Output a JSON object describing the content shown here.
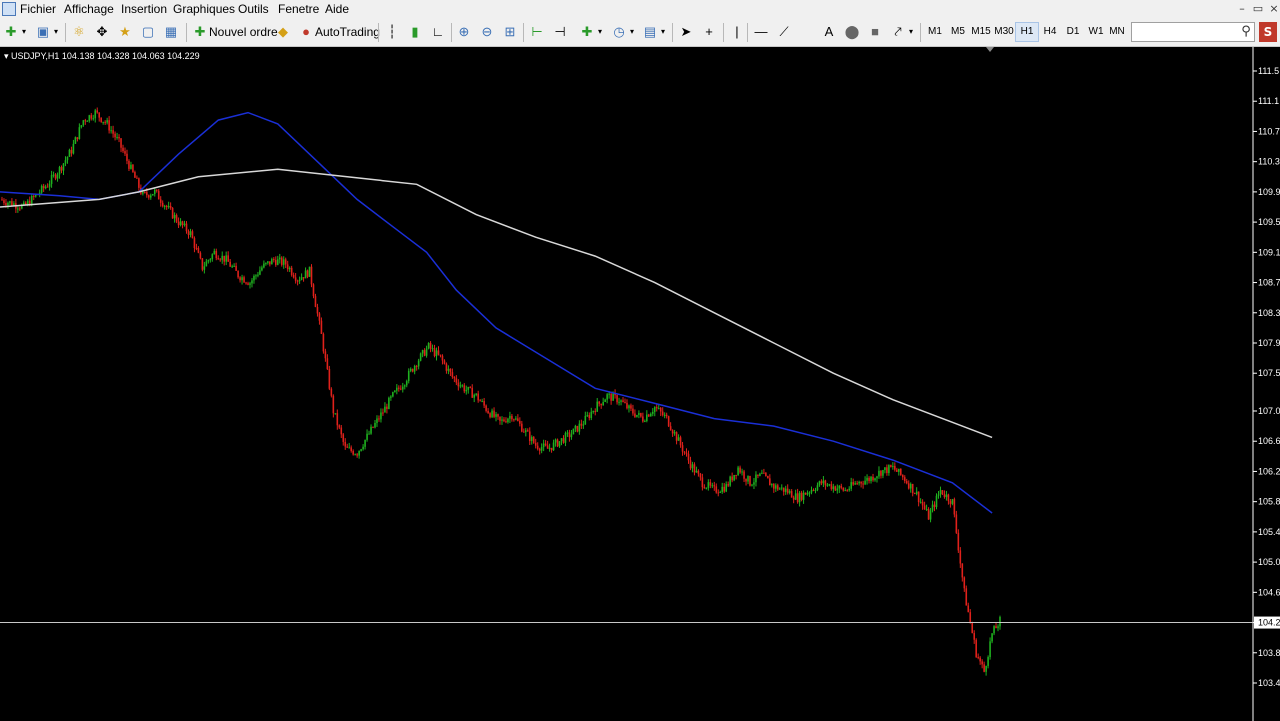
{
  "menu": {
    "items": [
      "Fichier",
      "Affichage",
      "Insertion",
      "Graphiques",
      "Outils",
      "Fenetre",
      "Aide"
    ]
  },
  "toolbar": {
    "new_order_label": "Nouvel ordre",
    "autotrading_label": "AutoTrading",
    "timeframes": [
      "M1",
      "M5",
      "M15",
      "M30",
      "H1",
      "H4",
      "D1",
      "W1",
      "MN"
    ],
    "active_timeframe": "H1",
    "search_value": ""
  },
  "chart_header": {
    "symbol_timeframe": "USDJPY,H1",
    "open": "104.138",
    "high": "104.328",
    "low": "104.063",
    "close": "104.229"
  },
  "colors": {
    "background": "#000000",
    "bull_candle": "#1fb11f",
    "bear_candle": "#e0211b",
    "ma_fast": "#1a2fd6",
    "ma_slow": "#d8d8d8",
    "price_line": "#c8c8c8",
    "axis_text": "#ffffff"
  },
  "chart_data": {
    "type": "candlestick",
    "symbol": "USDJPY",
    "timeframe": "H1",
    "ylim": [
      103.4,
      111.5
    ],
    "price_axis_ticks": [
      "111.5",
      "111.1",
      "110.7",
      "110.3",
      "109.9",
      "109.5",
      "109.1",
      "108.7",
      "108.3",
      "107.9",
      "107.5",
      "107.0",
      "106.6",
      "106.2",
      "105.8",
      "105.4",
      "105.0",
      "104.6",
      "104.2",
      "103.8",
      "103.4"
    ],
    "current_price": "104.2",
    "close_path": [
      [
        0,
        109.8
      ],
      [
        6,
        109.75
      ],
      [
        12,
        109.7
      ],
      [
        18,
        109.85
      ],
      [
        24,
        110.0
      ],
      [
        30,
        110.2
      ],
      [
        36,
        110.45
      ],
      [
        42,
        110.85
      ],
      [
        48,
        110.95
      ],
      [
        54,
        110.8
      ],
      [
        60,
        110.55
      ],
      [
        66,
        110.2
      ],
      [
        72,
        109.85
      ],
      [
        78,
        109.9
      ],
      [
        84,
        109.7
      ],
      [
        90,
        109.5
      ],
      [
        96,
        109.35
      ],
      [
        102,
        108.9
      ],
      [
        108,
        109.1
      ],
      [
        114,
        109.0
      ],
      [
        120,
        108.8
      ],
      [
        126,
        108.7
      ],
      [
        132,
        108.9
      ],
      [
        138,
        109.0
      ],
      [
        144,
        108.95
      ],
      [
        150,
        108.75
      ],
      [
        156,
        108.85
      ],
      [
        162,
        108.0
      ],
      [
        168,
        107.0
      ],
      [
        174,
        106.5
      ],
      [
        180,
        106.45
      ],
      [
        186,
        106.7
      ],
      [
        192,
        106.95
      ],
      [
        198,
        107.2
      ],
      [
        204,
        107.4
      ],
      [
        210,
        107.65
      ],
      [
        216,
        107.85
      ],
      [
        222,
        107.7
      ],
      [
        228,
        107.45
      ],
      [
        234,
        107.3
      ],
      [
        240,
        107.2
      ],
      [
        246,
        107.0
      ],
      [
        252,
        106.85
      ],
      [
        258,
        106.95
      ],
      [
        264,
        106.75
      ],
      [
        270,
        106.55
      ],
      [
        276,
        106.5
      ],
      [
        282,
        106.6
      ],
      [
        288,
        106.7
      ],
      [
        294,
        106.85
      ],
      [
        300,
        107.05
      ],
      [
        306,
        107.2
      ],
      [
        312,
        107.15
      ],
      [
        318,
        107.0
      ],
      [
        324,
        106.9
      ],
      [
        330,
        107.05
      ],
      [
        336,
        106.9
      ],
      [
        342,
        106.6
      ],
      [
        348,
        106.3
      ],
      [
        354,
        106.05
      ],
      [
        360,
        105.95
      ],
      [
        366,
        106.0
      ],
      [
        372,
        106.25
      ],
      [
        378,
        106.05
      ],
      [
        384,
        106.15
      ],
      [
        390,
        106.0
      ],
      [
        396,
        105.95
      ],
      [
        402,
        105.85
      ],
      [
        408,
        105.95
      ],
      [
        414,
        106.05
      ],
      [
        420,
        106.0
      ],
      [
        426,
        105.95
      ],
      [
        432,
        106.05
      ],
      [
        438,
        106.1
      ],
      [
        444,
        106.2
      ],
      [
        450,
        106.25
      ],
      [
        456,
        106.1
      ],
      [
        462,
        105.9
      ],
      [
        468,
        105.6
      ],
      [
        474,
        105.95
      ],
      [
        480,
        105.8
      ],
      [
        486,
        104.6
      ],
      [
        492,
        103.8
      ],
      [
        496,
        103.55
      ],
      [
        500,
        104.05
      ],
      [
        504,
        104.22
      ]
    ],
    "series": [
      {
        "type": "line",
        "values": [
          [
            0,
            109.9
          ],
          [
            30,
            109.85
          ],
          [
            50,
            109.8
          ],
          [
            70,
            109.9
          ],
          [
            90,
            110.4
          ],
          [
            110,
            110.85
          ],
          [
            125,
            110.95
          ],
          [
            140,
            110.8
          ],
          [
            160,
            110.3
          ],
          [
            180,
            109.8
          ],
          [
            200,
            109.4
          ],
          [
            215,
            109.1
          ],
          [
            230,
            108.6
          ],
          [
            250,
            108.1
          ],
          [
            275,
            107.7
          ],
          [
            300,
            107.3
          ],
          [
            330,
            107.1
          ],
          [
            360,
            106.9
          ],
          [
            390,
            106.8
          ],
          [
            420,
            106.6
          ],
          [
            450,
            106.35
          ],
          [
            480,
            106.05
          ],
          [
            500,
            105.65
          ]
        ]
      },
      {
        "type": "line",
        "values": [
          [
            0,
            109.7
          ],
          [
            50,
            109.8
          ],
          [
            70,
            109.9
          ],
          [
            100,
            110.1
          ],
          [
            140,
            110.2
          ],
          [
            175,
            110.1
          ],
          [
            210,
            110.0
          ],
          [
            240,
            109.6
          ],
          [
            270,
            109.3
          ],
          [
            300,
            109.05
          ],
          [
            330,
            108.7
          ],
          [
            360,
            108.3
          ],
          [
            390,
            107.9
          ],
          [
            420,
            107.5
          ],
          [
            450,
            107.15
          ],
          [
            480,
            106.85
          ],
          [
            500,
            106.65
          ]
        ]
      }
    ]
  }
}
